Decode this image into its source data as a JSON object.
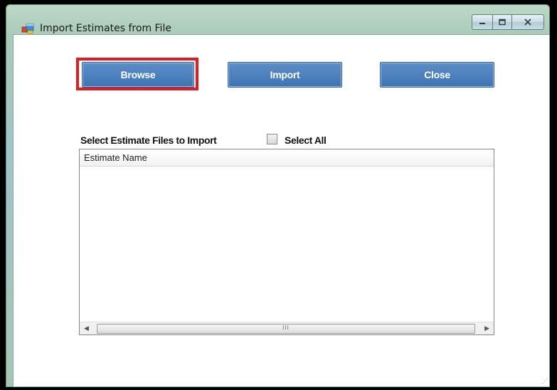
{
  "window": {
    "title": "Import Estimates from File",
    "controls": {
      "minimize": "minimize",
      "maximize": "maximize",
      "close": "close"
    }
  },
  "toolbar": {
    "browse_label": "Browse",
    "import_label": "Import",
    "close_label": "Close"
  },
  "selection": {
    "label": "Select Estimate Files to Import",
    "select_all_label": "Select All",
    "select_all_checked": false
  },
  "list": {
    "columns": [
      "Estimate Name"
    ],
    "rows": [],
    "scroll_grip": "III"
  },
  "colors": {
    "button_blue": "#3f74b4",
    "highlight_red": "#e21a22"
  },
  "icons": {
    "app": "app-window-icon",
    "scroll_left": "chevron-left-icon",
    "scroll_right": "chevron-right-icon"
  }
}
